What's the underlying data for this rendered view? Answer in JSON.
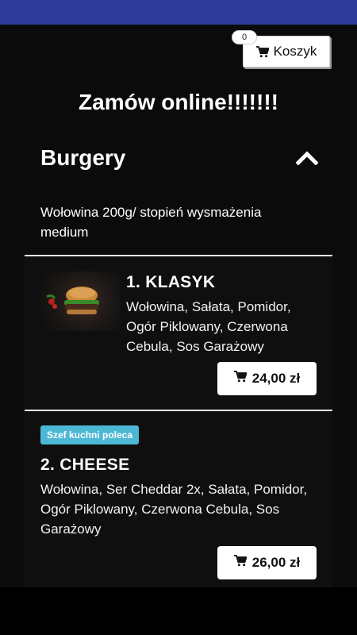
{
  "header": {
    "cart_label": "Koszyk",
    "cart_count": "0"
  },
  "page": {
    "title": "Zamów online!!!!!!!"
  },
  "section": {
    "title": "Burgery",
    "description": "Wołowina 200g/ stopień wysmażenia medium"
  },
  "products": [
    {
      "name": "1. KLASYK",
      "description": "Wołowina, Sałata, Pomidor, Ogór Piklowany, Czerwona Cebula, Sos Garażowy",
      "price": "24,00 zł"
    },
    {
      "badge": "Szef kuchni poleca",
      "name": "2. CHEESE",
      "description": "Wołowina, Ser Cheddar 2x, Sałata, Pomidor, Ogór Piklowany, Czerwona Cebula, Sos Garażowy",
      "price": "26,00 zł"
    }
  ],
  "colors": {
    "status_bar": "#2f3b98",
    "badge": "#4db7d6",
    "background": "#0b0b0c"
  },
  "icons": {
    "cart": "cart-icon",
    "collapse": "chevron-up-icon"
  }
}
